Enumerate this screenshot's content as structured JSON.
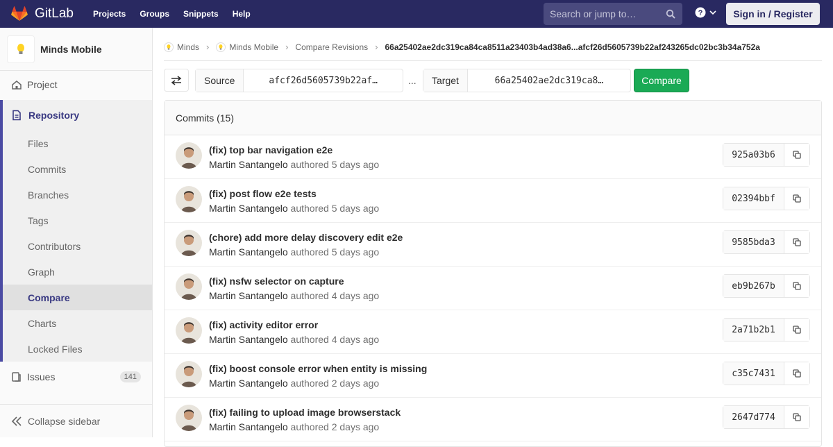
{
  "navbar": {
    "brand": "GitLab",
    "links": [
      "Projects",
      "Groups",
      "Snippets",
      "Help"
    ],
    "search_placeholder": "Search or jump to…",
    "signin": "Sign in / Register",
    "bg": "#292961"
  },
  "sidebar": {
    "project_name": "Minds Mobile",
    "project": "Project",
    "repository": "Repository",
    "subitems": [
      "Files",
      "Commits",
      "Branches",
      "Tags",
      "Contributors",
      "Graph",
      "Compare",
      "Charts",
      "Locked Files"
    ],
    "active": "Compare",
    "issues": "Issues",
    "issues_count": "141",
    "collapse": "Collapse sidebar"
  },
  "breadcrumb": {
    "items": [
      "Minds",
      "Minds Mobile",
      "Compare Revisions"
    ],
    "current": "66a25402ae2dc319ca84ca8511a23403b4ad38a6...afcf26d5605739b22af243265dc02bc3b34a752a"
  },
  "compare_form": {
    "source_label": "Source",
    "source_value": "afcf26d5605739b22af…",
    "dots": "...",
    "target_label": "Target",
    "target_value": "66a25402ae2dc319ca8…",
    "button": "Compare",
    "button_color": "#1aaa55"
  },
  "commits": {
    "header": "Commits (15)",
    "items": [
      {
        "title": "(fix) top bar navigation e2e",
        "author": "Martin Santangelo",
        "authored": "authored",
        "when": "5 days ago",
        "sha": "925a03b6"
      },
      {
        "title": "(fix) post flow e2e tests",
        "author": "Martin Santangelo",
        "authored": "authored",
        "when": "5 days ago",
        "sha": "02394bbf"
      },
      {
        "title": "(chore) add more delay discovery edit e2e",
        "author": "Martin Santangelo",
        "authored": "authored",
        "when": "5 days ago",
        "sha": "9585bda3"
      },
      {
        "title": "(fix) nsfw selector on capture",
        "author": "Martin Santangelo",
        "authored": "authored",
        "when": "4 days ago",
        "sha": "eb9b267b"
      },
      {
        "title": "(fix) activity editor error",
        "author": "Martin Santangelo",
        "authored": "authored",
        "when": "4 days ago",
        "sha": "2a71b2b1"
      },
      {
        "title": "(fix) boost console error when entity is missing",
        "author": "Martin Santangelo",
        "authored": "authored",
        "when": "2 days ago",
        "sha": "c35c7431"
      },
      {
        "title": "(fix) failing to upload image browserstack",
        "author": "Martin Santangelo",
        "authored": "authored",
        "when": "2 days ago",
        "sha": "2647d774"
      }
    ]
  }
}
